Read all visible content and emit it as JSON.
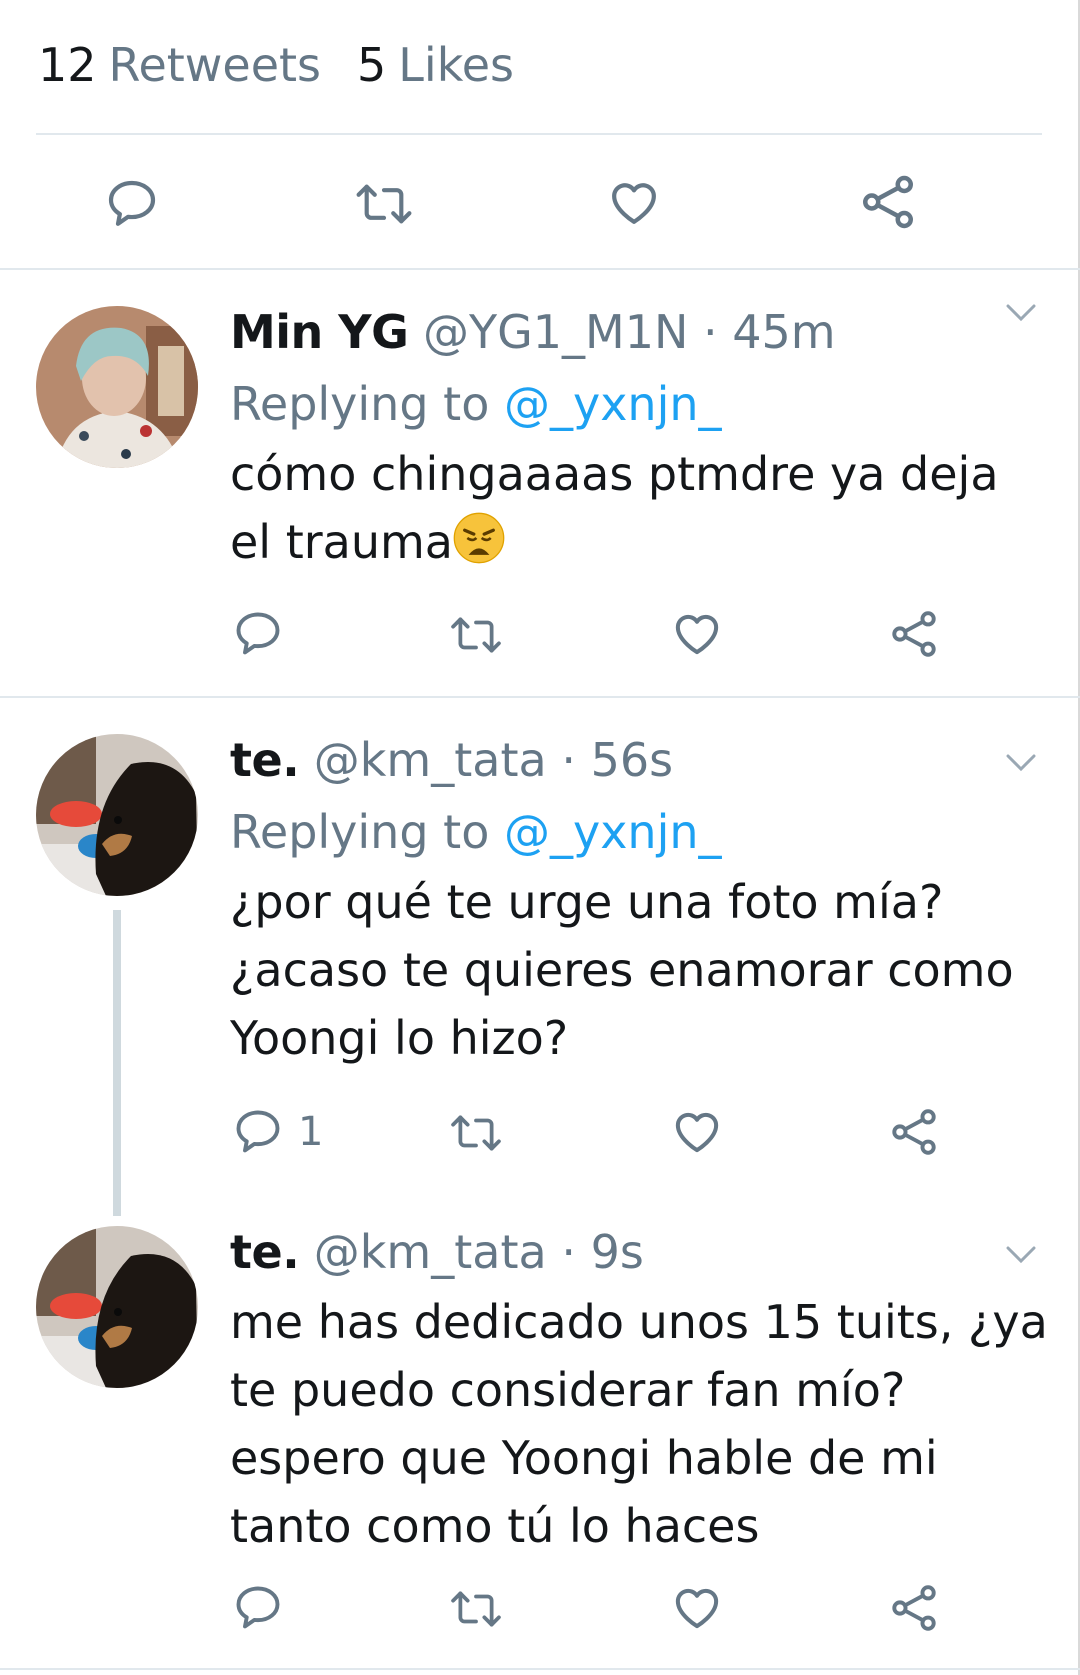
{
  "stats": {
    "retweets_count": "12",
    "retweets_label": "Retweets",
    "likes_count": "5",
    "likes_label": "Likes"
  },
  "tweets": [
    {
      "name": "Min YG",
      "handle": "@YG1_M1N",
      "time": "45m",
      "replying_prefix": "Replying to ",
      "replying_to": "@_yxnjn_",
      "text": "cómo chingaaaas ptmdre ya deja el trauma",
      "emoji": "weary-face",
      "reply_count": ""
    },
    {
      "name": "te.",
      "handle": "@km_tata",
      "time": "56s",
      "replying_prefix": "Replying to ",
      "replying_to": "@_yxnjn_",
      "text": "¿por qué te urge una foto mía? ¿acaso te quieres enamorar como Yoongi lo hizo?",
      "reply_count": "1"
    },
    {
      "name": "te.",
      "handle": "@km_tata",
      "time": "9s",
      "text": "me has dedicado unos 15 tuits, ¿ya te puedo considerar fan mío? espero que Yoongi hable de mi tanto como tú lo haces",
      "reply_count": ""
    }
  ],
  "separator": "·",
  "colors": {
    "text": "#14171a",
    "secondary": "#657786",
    "link": "#1da1f2",
    "divider": "#e1e8ed"
  }
}
